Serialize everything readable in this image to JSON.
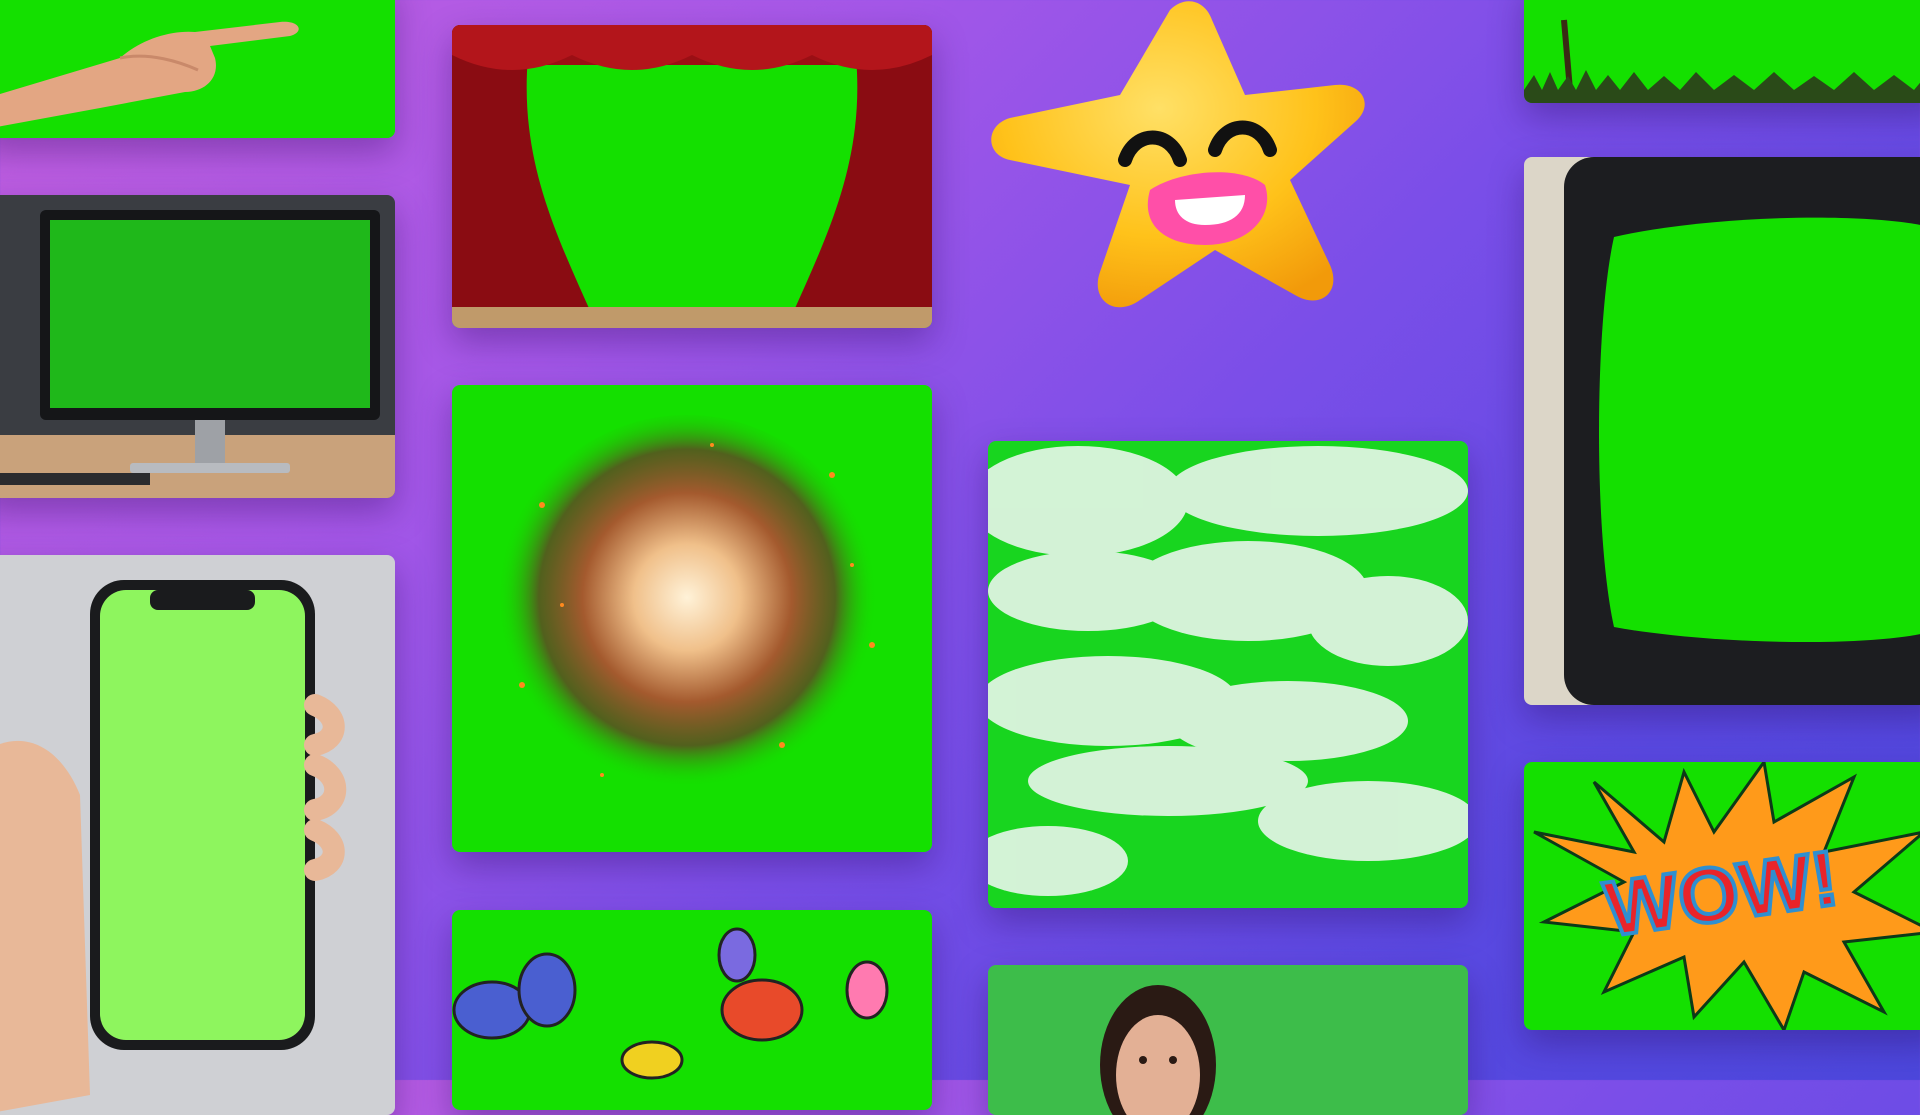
{
  "collage": {
    "tiles": [
      {
        "id": "hand",
        "subject": "hand-pointing-green-screen"
      },
      {
        "id": "monitor",
        "subject": "desktop-monitor-green-screen"
      },
      {
        "id": "phone",
        "subject": "hand-holding-phone-green-screen"
      },
      {
        "id": "theater",
        "subject": "red-theater-curtain-green-screen"
      },
      {
        "id": "explosion",
        "subject": "fire-explosion-green-screen"
      },
      {
        "id": "butterflies",
        "subject": "cartoon-butterflies-green-screen"
      },
      {
        "id": "star",
        "subject": "smiling-star-sticker"
      },
      {
        "id": "clouds",
        "subject": "clouds-green-screen"
      },
      {
        "id": "presenter",
        "subject": "woman-presenter-green-screen"
      },
      {
        "id": "grass",
        "subject": "palm-and-grass-green-screen"
      },
      {
        "id": "tv",
        "subject": "retro-tv-green-screen"
      },
      {
        "id": "wow",
        "subject": "comic-burst-green-screen"
      }
    ],
    "wow_text": "WOW!"
  },
  "colors": {
    "chroma_green": "#14e000",
    "background_start": "#c35fe0",
    "background_end": "#4c47dc",
    "curtain_red": "#9a0f14",
    "star_yellow": "#ffc21a",
    "wow_orange": "#ff9a1a",
    "wow_red": "#e8242a",
    "wow_blue": "#2f8fd0"
  }
}
